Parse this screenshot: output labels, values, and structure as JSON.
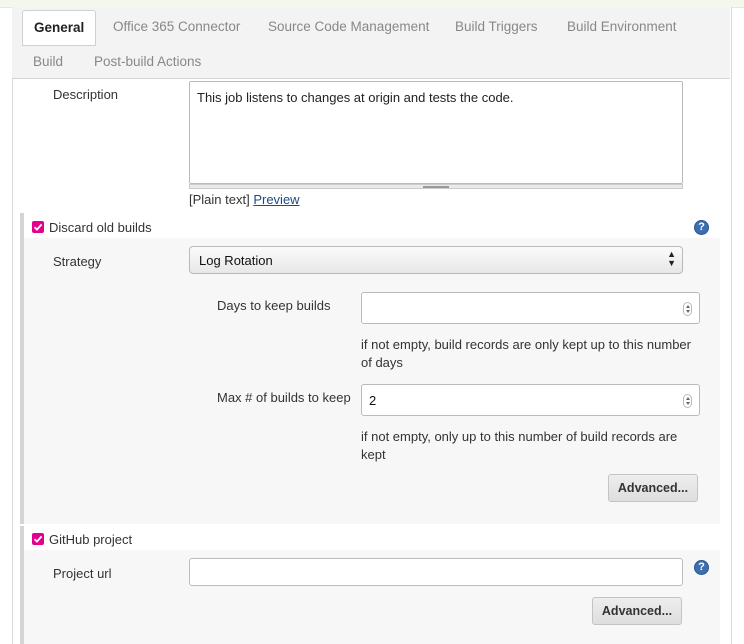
{
  "tabs": [
    {
      "label": "General"
    },
    {
      "label": "Office 365 Connector"
    },
    {
      "label": "Source Code Management"
    },
    {
      "label": "Build Triggers"
    },
    {
      "label": "Build Environment"
    },
    {
      "label": "Build"
    },
    {
      "label": "Post-build Actions"
    }
  ],
  "description": {
    "label": "Description",
    "value": "This job listens to changes at origin and tests the code.",
    "plain_text": "[Plain text]",
    "preview_link": "Preview"
  },
  "discard_old_builds": {
    "label": "Discard old builds",
    "checked": true,
    "strategy_label": "Strategy",
    "strategy_value": "Log Rotation",
    "days_label": "Days to keep builds",
    "days_value": "",
    "days_hint": "if not empty, build records are only kept up to this number of days",
    "max_label": "Max # of builds to keep",
    "max_value": "2",
    "max_hint": "if not empty, only up to this number of build records are kept",
    "advanced_label": "Advanced..."
  },
  "github_project": {
    "label": "GitHub project",
    "checked": true,
    "url_label": "Project url",
    "url_value": "",
    "advanced_label": "Advanced..."
  },
  "colors": {
    "checkbox": "#e4008c",
    "help_icon": "#3c6fb0",
    "link": "#204a87"
  }
}
